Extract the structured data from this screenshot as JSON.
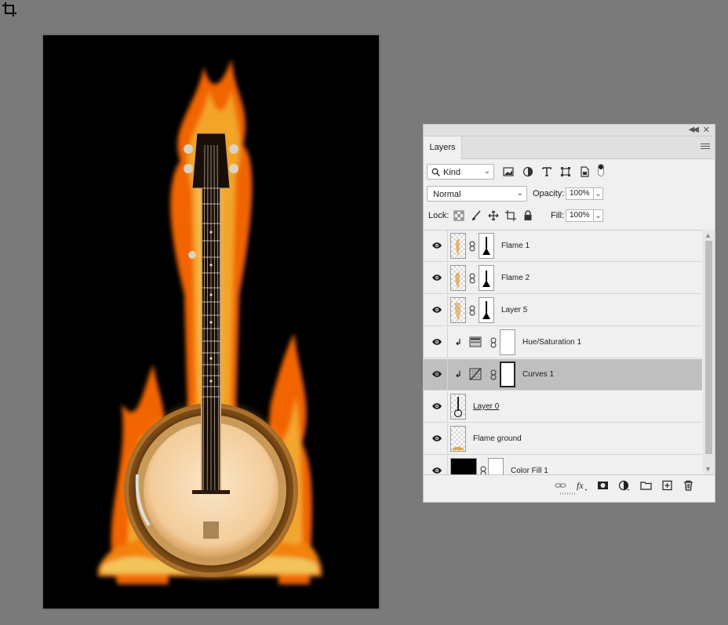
{
  "panel": {
    "tab_label": "Layers",
    "filter": {
      "selected": "Kind"
    },
    "blend_mode": "Normal",
    "opacity_label": "Opacity:",
    "opacity_value": "100%",
    "lock_label": "Lock:",
    "fill_label": "Fill:",
    "fill_value": "100%"
  },
  "layers": [
    {
      "name": "Flame 1",
      "kind": "pixel-mask",
      "visible": true,
      "selected": false
    },
    {
      "name": "Flame 2",
      "kind": "pixel-mask",
      "visible": true,
      "selected": false
    },
    {
      "name": "Layer 5",
      "kind": "pixel-mask",
      "visible": true,
      "selected": false
    },
    {
      "name": "Hue/Saturation 1",
      "kind": "adjustment",
      "adjustment_icon": "hue-saturation-icon",
      "clipped": true,
      "visible": true,
      "selected": false
    },
    {
      "name": "Curves 1",
      "kind": "adjustment",
      "adjustment_icon": "curves-icon",
      "clipped": true,
      "visible": true,
      "selected": true
    },
    {
      "name": "Layer 0",
      "kind": "pixel",
      "visible": true,
      "selected": false
    },
    {
      "name": "Flame ground",
      "kind": "pixel",
      "visible": true,
      "selected": false
    },
    {
      "name": "Color Fill 1",
      "kind": "fill",
      "visible": true,
      "selected": false
    }
  ],
  "colors": {
    "selected_row": "#bfbfbf",
    "panel_bg": "#f0f0f0",
    "workspace_bg": "#7a7a7a",
    "canvas_bg": "#000000"
  }
}
